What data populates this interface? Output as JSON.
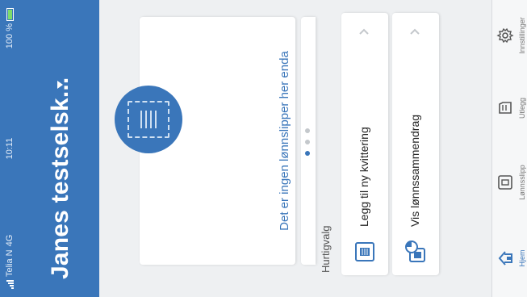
{
  "status_bar": {
    "carrier": "Telia N",
    "network": "4G",
    "time": "10:11",
    "battery": "100 %"
  },
  "header": {
    "title": "Janes testselsk..."
  },
  "card": {
    "message": "Det er ingen lønnslipper her enda"
  },
  "quick_actions": {
    "title": "Hurtigvalg",
    "items": [
      {
        "label": "Legg til ny kvittering",
        "icon": "receipt-icon"
      },
      {
        "label": "Vis lønnssammendrag",
        "icon": "summary-chart-icon"
      }
    ]
  },
  "tabs": [
    {
      "label": "Hjem",
      "icon": "home-icon",
      "active": true
    },
    {
      "label": "Lønnsslipp",
      "icon": "payslip-icon",
      "active": false
    },
    {
      "label": "Utlegg",
      "icon": "expense-icon",
      "active": false
    },
    {
      "label": "Innstillinger",
      "icon": "gear-icon",
      "active": false
    }
  ],
  "colors": {
    "brand_blue": "#3a76ba",
    "background": "#eef0f2",
    "battery_green": "#7ddc6a"
  }
}
